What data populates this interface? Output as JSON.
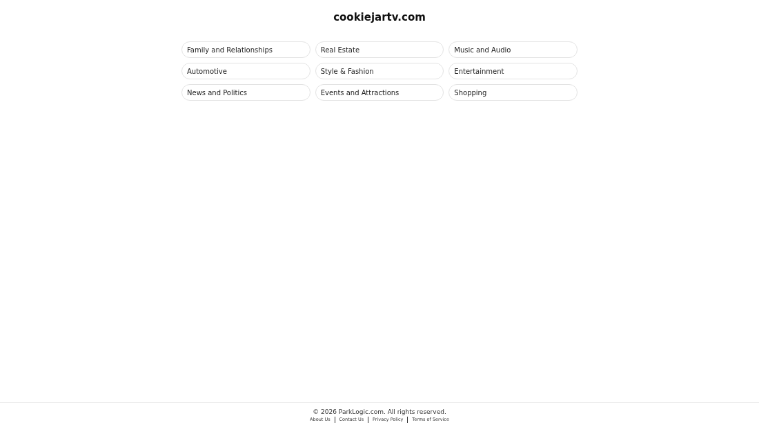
{
  "header": {
    "title": "cookiejartv.com"
  },
  "categories": [
    "Family and Relationships",
    "Real Estate",
    "Music and Audio",
    "Automotive",
    "Style & Fashion",
    "Entertainment",
    "News and Politics",
    "Events and Attractions",
    "Shopping"
  ],
  "footer": {
    "copyright": "© 2026 ParkLogic.com. All rights reserved.",
    "links": [
      "About Us",
      "Contact Us",
      "Privacy Policy",
      "Terms of Service"
    ]
  }
}
